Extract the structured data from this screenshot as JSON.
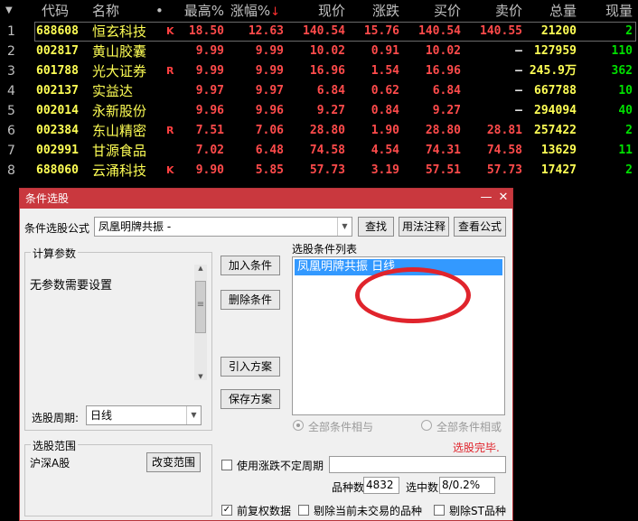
{
  "table": {
    "headers": {
      "code": "代码",
      "name": "名称",
      "dot": "•",
      "high_pct": "最高%",
      "change_pct": "涨幅%",
      "sort_arrow": "↓",
      "price": "现价",
      "change": "涨跌",
      "bid": "买价",
      "ask": "卖价",
      "volume": "总量",
      "current_volume": "现量"
    },
    "rows": [
      {
        "no": "1",
        "code": "688608",
        "name": "恒玄科技",
        "mark": "K",
        "high_pct": "18.50",
        "change_pct": "12.63",
        "price": "140.54",
        "change": "15.76",
        "bid": "140.54",
        "ask": "140.55",
        "volume": "21200",
        "current_volume": "2"
      },
      {
        "no": "2",
        "code": "002817",
        "name": "黄山胶囊",
        "mark": "",
        "high_pct": "9.99",
        "change_pct": "9.99",
        "price": "10.02",
        "change": "0.91",
        "bid": "10.02",
        "ask": "—",
        "volume": "127959",
        "current_volume": "110"
      },
      {
        "no": "3",
        "code": "601788",
        "name": "光大证券",
        "mark": "R",
        "high_pct": "9.99",
        "change_pct": "9.99",
        "price": "16.96",
        "change": "1.54",
        "bid": "16.96",
        "ask": "—",
        "volume": "245.9万",
        "current_volume": "362"
      },
      {
        "no": "4",
        "code": "002137",
        "name": "实益达",
        "mark": "",
        "high_pct": "9.97",
        "change_pct": "9.97",
        "price": "6.84",
        "change": "0.62",
        "bid": "6.84",
        "ask": "—",
        "volume": "667788",
        "current_volume": "10"
      },
      {
        "no": "5",
        "code": "002014",
        "name": "永新股份",
        "mark": "",
        "high_pct": "9.96",
        "change_pct": "9.96",
        "price": "9.27",
        "change": "0.84",
        "bid": "9.27",
        "ask": "—",
        "volume": "294094",
        "current_volume": "40"
      },
      {
        "no": "6",
        "code": "002384",
        "name": "东山精密",
        "mark": "R",
        "high_pct": "7.51",
        "change_pct": "7.06",
        "price": "28.80",
        "change": "1.90",
        "bid": "28.80",
        "ask": "28.81",
        "volume": "257422",
        "current_volume": "2"
      },
      {
        "no": "7",
        "code": "002991",
        "name": "甘源食品",
        "mark": "",
        "high_pct": "7.02",
        "change_pct": "6.48",
        "price": "74.58",
        "change": "4.54",
        "bid": "74.31",
        "ask": "74.58",
        "volume": "13629",
        "current_volume": "11"
      },
      {
        "no": "8",
        "code": "688060",
        "name": "云涌科技",
        "mark": "K",
        "high_pct": "9.90",
        "change_pct": "5.85",
        "price": "57.73",
        "change": "3.19",
        "bid": "57.51",
        "ask": "57.73",
        "volume": "17427",
        "current_volume": "2"
      }
    ]
  },
  "dialog": {
    "title": "条件选股",
    "minimize_glyph": "—",
    "close_glyph": "✕",
    "formula_label": "条件选股公式",
    "formula_value": "凤凰明牌共振 -",
    "dropdown_glyph": "▼",
    "find_button": "查找",
    "usage_button": "用法注释",
    "view_formula_button": "查看公式",
    "params_group": "计算参数",
    "params_text": "无参数需要设置",
    "scroll_up": "▲",
    "scroll_down": "▼",
    "scroll_grip": "≡",
    "add_condition": "加入条件",
    "delete_condition": "删除条件",
    "import_plan": "引入方案",
    "save_plan": "保存方案",
    "condition_list_label": "选股条件列表",
    "condition_item": "凤凰明牌共振  日线",
    "period_label": "选股周期:",
    "period_value": "日线",
    "radio_and": "全部条件相与",
    "radio_or": "全部条件相或",
    "status": "选股完毕.",
    "scope_group": "选股范围",
    "scope_value": "沪深A股",
    "change_scope": "改变范围",
    "variable_period_label": "使用涨跌不定周期",
    "count_label": "品种数",
    "count_value": "4832",
    "selected_label": "选中数",
    "selected_value": "8/0.2%",
    "prev_adjust_label": "前复权数据",
    "prev_adjust_check": "✓",
    "exclude_suspended_label": "剔除当前未交易的品种",
    "exclude_st_label": "剔除ST品种"
  },
  "colors": {
    "up": "#ff4b4b",
    "name": "#ffff55",
    "volume_up": "#00e000",
    "titlebar": "#c9383e",
    "selection": "#3399ff",
    "annotation": "#e0242c"
  }
}
